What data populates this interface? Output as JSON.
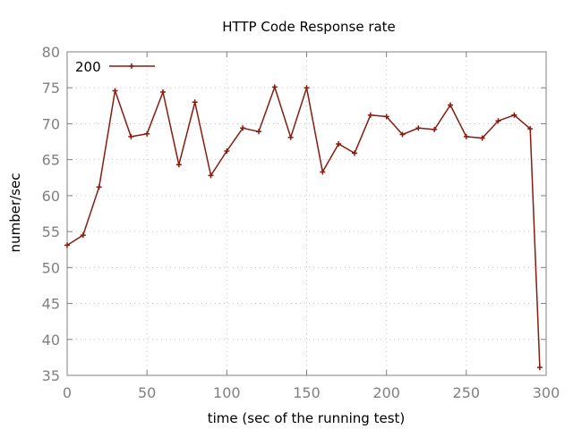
{
  "chart_data": {
    "type": "line",
    "title": "HTTP Code Response rate",
    "xlabel": "time (sec of the running test)",
    "ylabel": "number/sec",
    "xlim": [
      0,
      300
    ],
    "ylim": [
      35,
      80
    ],
    "x_ticks": [
      0,
      50,
      100,
      150,
      200,
      250,
      300
    ],
    "y_ticks": [
      35,
      40,
      45,
      50,
      55,
      60,
      65,
      70,
      75,
      80
    ],
    "grid": true,
    "legend_position": "top-left",
    "series": [
      {
        "name": "200",
        "color": "#8b1a0e",
        "marker": "plus",
        "points": [
          [
            0,
            53.1
          ],
          [
            10,
            54.5
          ],
          [
            20,
            61.2
          ],
          [
            30,
            74.6
          ],
          [
            40,
            68.2
          ],
          [
            50,
            68.6
          ],
          [
            60,
            74.4
          ],
          [
            70,
            64.3
          ],
          [
            80,
            73.0
          ],
          [
            90,
            62.8
          ],
          [
            100,
            66.2
          ],
          [
            110,
            69.4
          ],
          [
            120,
            68.9
          ],
          [
            130,
            75.1
          ],
          [
            140,
            68.1
          ],
          [
            150,
            75.0
          ],
          [
            160,
            63.3
          ],
          [
            170,
            67.2
          ],
          [
            180,
            65.9
          ],
          [
            190,
            71.2
          ],
          [
            200,
            71.0
          ],
          [
            210,
            68.5
          ],
          [
            220,
            69.4
          ],
          [
            230,
            69.2
          ],
          [
            240,
            72.6
          ],
          [
            250,
            68.2
          ],
          [
            260,
            68.0
          ],
          [
            270,
            70.4
          ],
          [
            280,
            71.2
          ],
          [
            290,
            69.3
          ],
          [
            296,
            36.1
          ]
        ]
      }
    ]
  }
}
